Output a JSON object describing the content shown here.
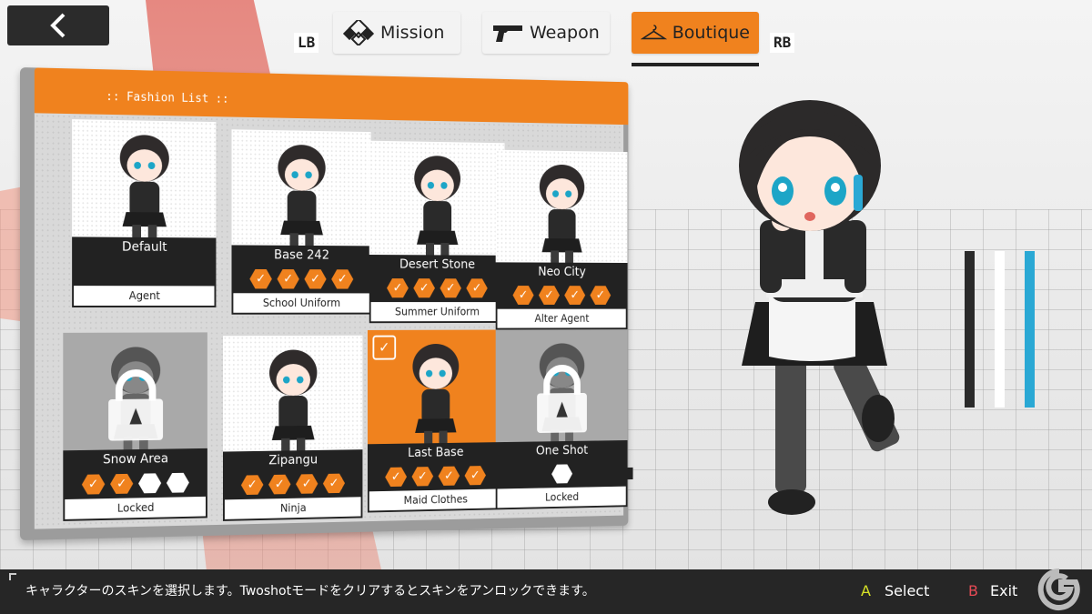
{
  "nav": {
    "lb": "LB",
    "rb": "RB",
    "tabs": [
      {
        "label": "Mission",
        "icon": "mission-icon",
        "active": false
      },
      {
        "label": "Weapon",
        "icon": "pistol-icon",
        "active": false
      },
      {
        "label": "Boutique",
        "icon": "hanger-icon",
        "active": true
      }
    ]
  },
  "panel": {
    "title": ":: Fashion List ::",
    "cards": [
      {
        "name": "Default",
        "type": "Agent",
        "stars": [],
        "state": "normal"
      },
      {
        "name": "Base 242",
        "type": "School Uniform",
        "stars": [
          "on",
          "on",
          "on",
          "on"
        ],
        "state": "normal"
      },
      {
        "name": "Desert Stone",
        "type": "Summer Uniform",
        "stars": [
          "on",
          "on",
          "on",
          "on"
        ],
        "state": "normal"
      },
      {
        "name": "Neo City",
        "type": "Alter Agent",
        "stars": [
          "on",
          "on",
          "on",
          "on"
        ],
        "state": "normal"
      },
      {
        "name": "Snow Area",
        "type": "Locked",
        "stars": [
          "on",
          "on",
          "off",
          "off"
        ],
        "state": "locked"
      },
      {
        "name": "Zipangu",
        "type": "Ninja",
        "stars": [
          "on",
          "on",
          "on",
          "on"
        ],
        "state": "normal"
      },
      {
        "name": "Last Base",
        "type": "Maid Clothes",
        "stars": [
          "on",
          "on",
          "on",
          "on"
        ],
        "state": "selected"
      },
      {
        "name": "One Shot",
        "type": "Locked",
        "stars": [
          "off"
        ],
        "state": "locked"
      }
    ]
  },
  "colors": {
    "accent": "#f0821e",
    "dark": "#222222",
    "bar1": "#2a2a2a",
    "bar2": "#ffffff",
    "bar3": "#2aa8d4",
    "select_key": "#d7e227",
    "exit_key": "#e64a55"
  },
  "footer": {
    "help": "キャラクターのスキンを選択します。Twoshotモードをクリアするとスキンをアンロックできます。",
    "a_key": "A",
    "a_label": "Select",
    "b_key": "B",
    "b_label": "Exit"
  }
}
